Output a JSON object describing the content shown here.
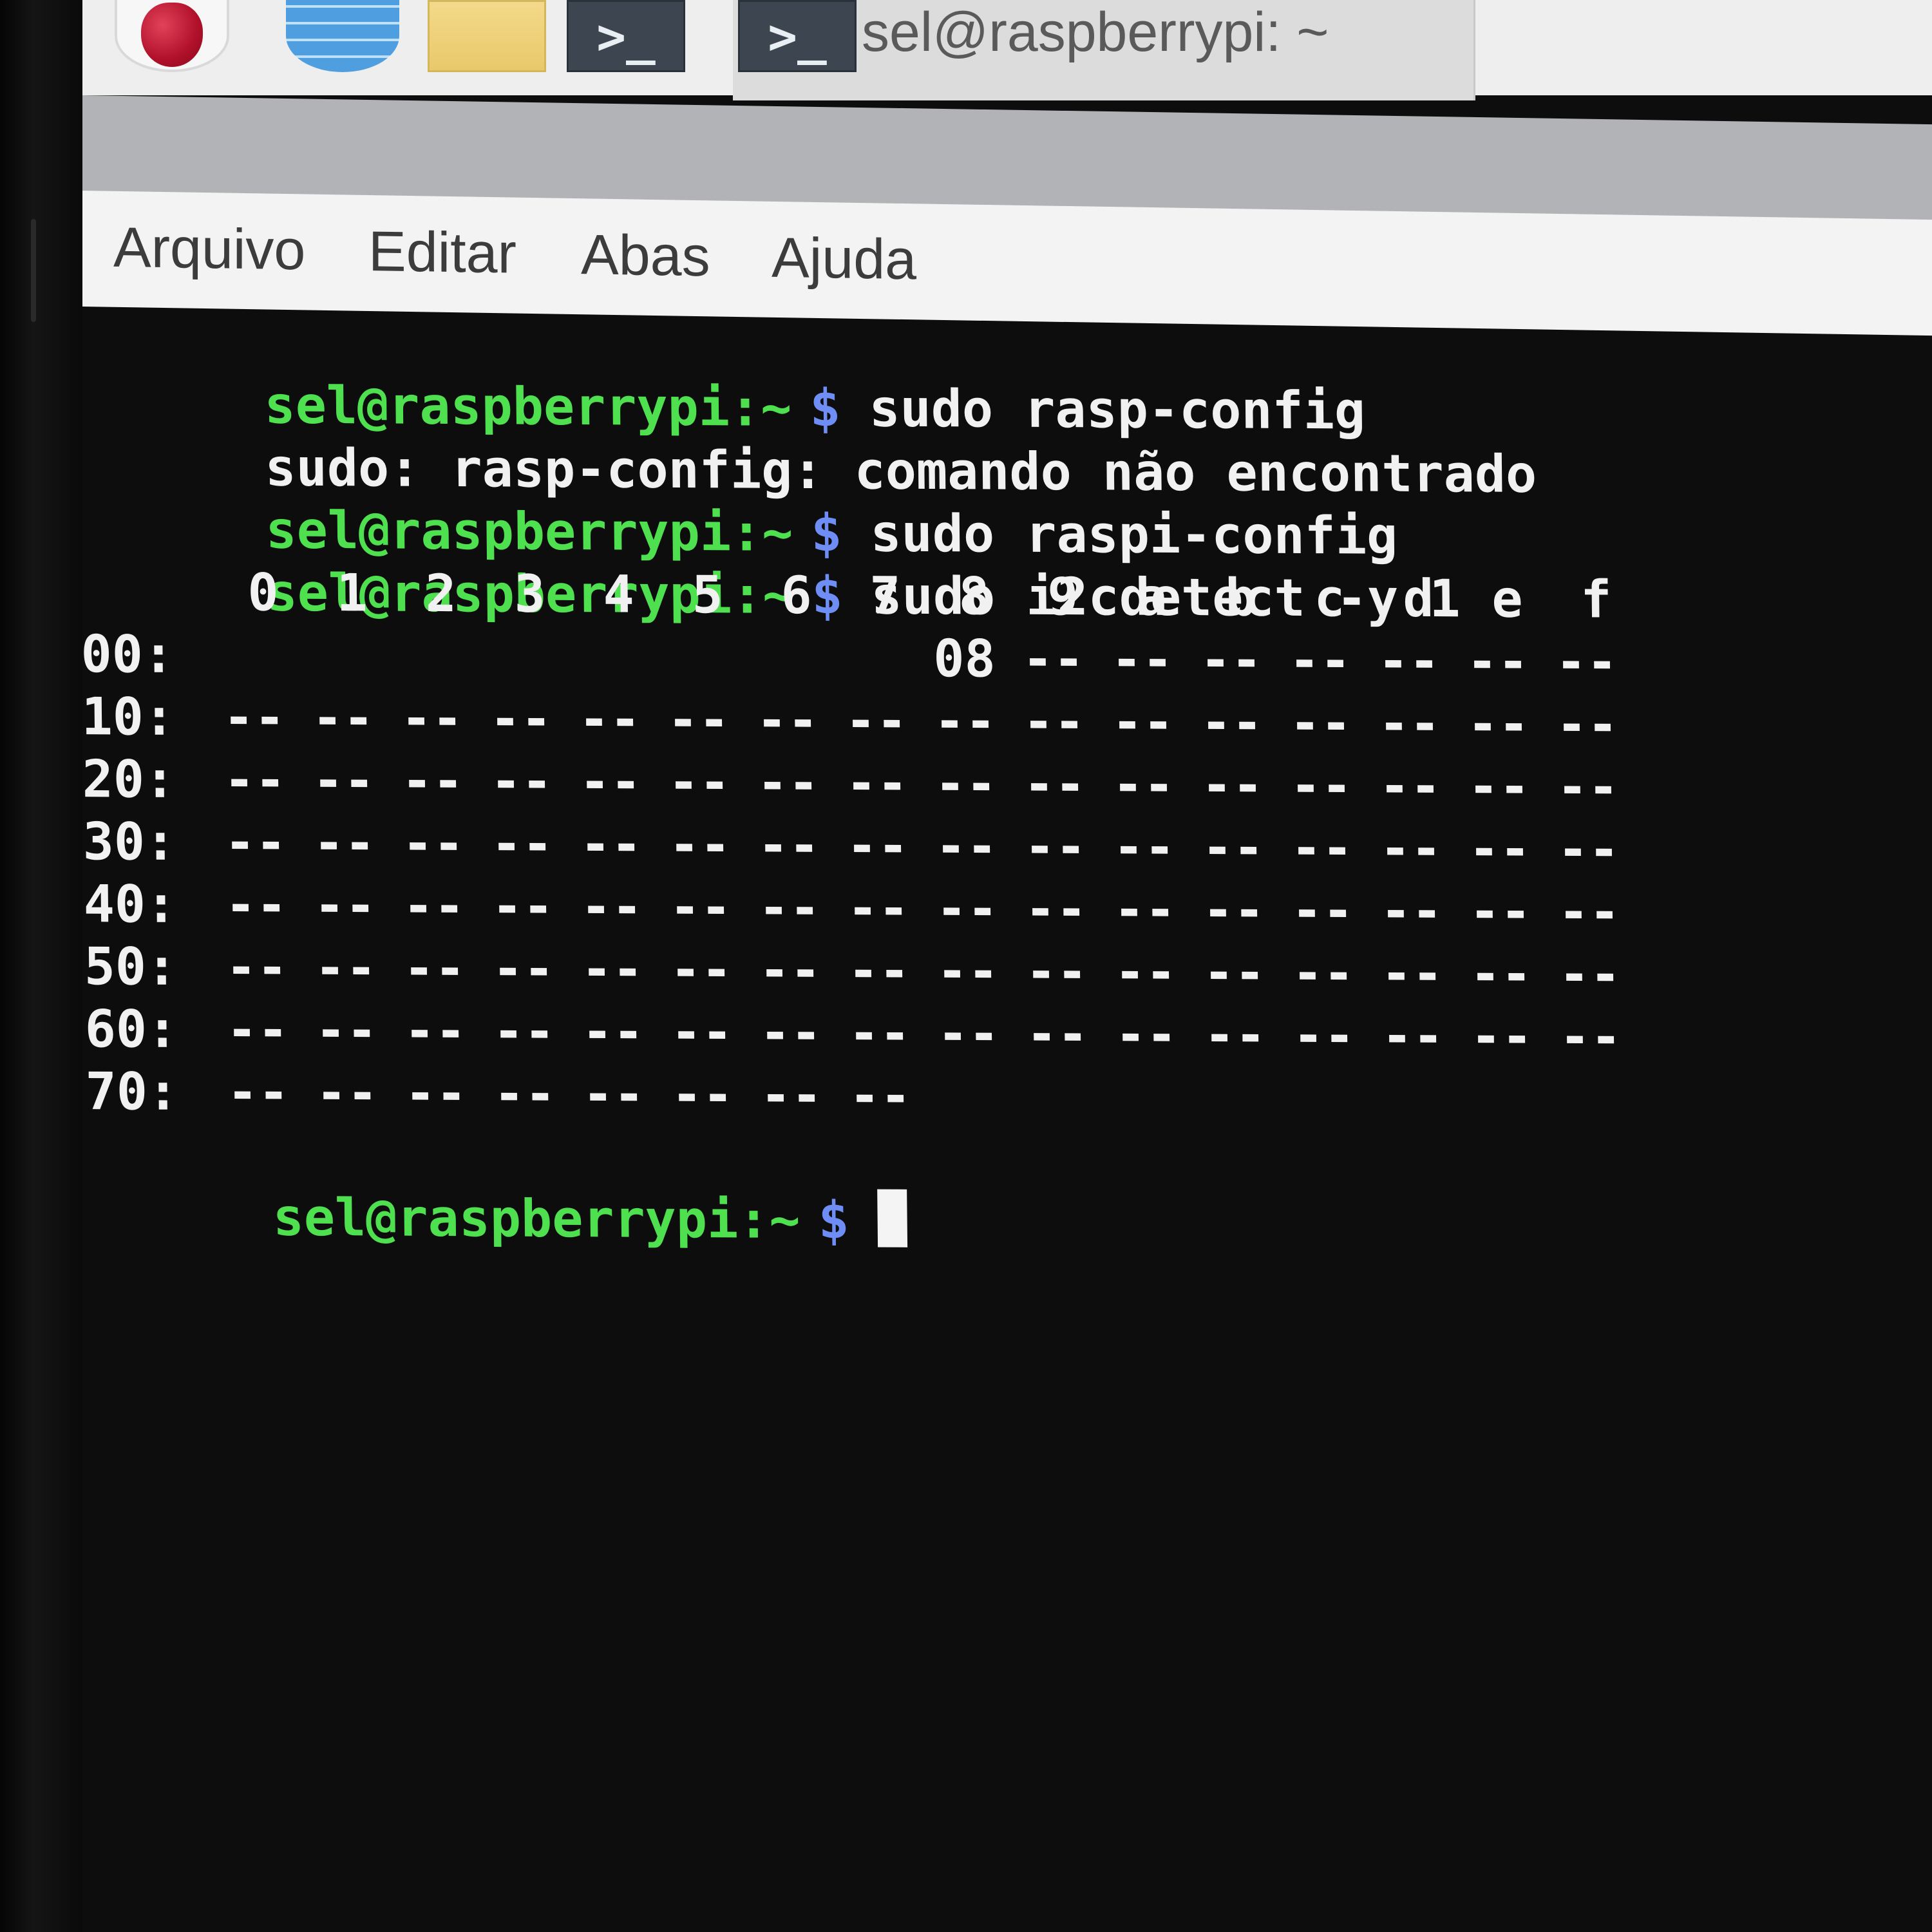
{
  "taskbar": {
    "icons": [
      "raspberry-menu-icon",
      "web-browser-icon",
      "file-manager-icon",
      "terminal-icon"
    ],
    "terminal_glyph": ">_",
    "active_window_title": "sel@raspberrypi: ~"
  },
  "menubar": {
    "items": [
      "Arquivo",
      "Editar",
      "Abas",
      "Ajuda"
    ]
  },
  "terminal": {
    "prompt": {
      "user_host": "sel@raspberrypi:~",
      "symbol": "$"
    },
    "lines": [
      {
        "type": "command",
        "text": "sudo rasp-config"
      },
      {
        "type": "output",
        "text": "sudo: rasp-config: comando não encontrado"
      },
      {
        "type": "command",
        "text": "sudo raspi-config"
      },
      {
        "type": "command",
        "text": "sudo i2cdetect -y 1"
      }
    ],
    "i2c_table": {
      "columns": [
        "0",
        "1",
        "2",
        "3",
        "4",
        "5",
        "6",
        "7",
        "8",
        "9",
        "a",
        "b",
        "c",
        "d",
        "e",
        "f"
      ],
      "rows": [
        {
          "label": "00:",
          "cells": [
            "",
            "",
            "",
            "",
            "",
            "",
            "",
            "",
            "08",
            "--",
            "--",
            "--",
            "--",
            "--",
            "--",
            "--"
          ]
        },
        {
          "label": "10:",
          "cells": [
            "--",
            "--",
            "--",
            "--",
            "--",
            "--",
            "--",
            "--",
            "--",
            "--",
            "--",
            "--",
            "--",
            "--",
            "--",
            "--"
          ]
        },
        {
          "label": "20:",
          "cells": [
            "--",
            "--",
            "--",
            "--",
            "--",
            "--",
            "--",
            "--",
            "--",
            "--",
            "--",
            "--",
            "--",
            "--",
            "--",
            "--"
          ]
        },
        {
          "label": "30:",
          "cells": [
            "--",
            "--",
            "--",
            "--",
            "--",
            "--",
            "--",
            "--",
            "--",
            "--",
            "--",
            "--",
            "--",
            "--",
            "--",
            "--"
          ]
        },
        {
          "label": "40:",
          "cells": [
            "--",
            "--",
            "--",
            "--",
            "--",
            "--",
            "--",
            "--",
            "--",
            "--",
            "--",
            "--",
            "--",
            "--",
            "--",
            "--"
          ]
        },
        {
          "label": "50:",
          "cells": [
            "--",
            "--",
            "--",
            "--",
            "--",
            "--",
            "--",
            "--",
            "--",
            "--",
            "--",
            "--",
            "--",
            "--",
            "--",
            "--"
          ]
        },
        {
          "label": "60:",
          "cells": [
            "--",
            "--",
            "--",
            "--",
            "--",
            "--",
            "--",
            "--",
            "--",
            "--",
            "--",
            "--",
            "--",
            "--",
            "--",
            "--"
          ]
        },
        {
          "label": "70:",
          "cells": [
            "--",
            "--",
            "--",
            "--",
            "--",
            "--",
            "--",
            "--",
            "",
            "",
            "",
            "",
            "",
            "",
            "",
            ""
          ]
        }
      ]
    },
    "final_prompt_input": ""
  },
  "colors": {
    "prompt_user": "#4fe04f",
    "prompt_symbol": "#6e8ef5",
    "terminal_text": "#f1f1f1",
    "terminal_bg": "#0e0d0d"
  }
}
